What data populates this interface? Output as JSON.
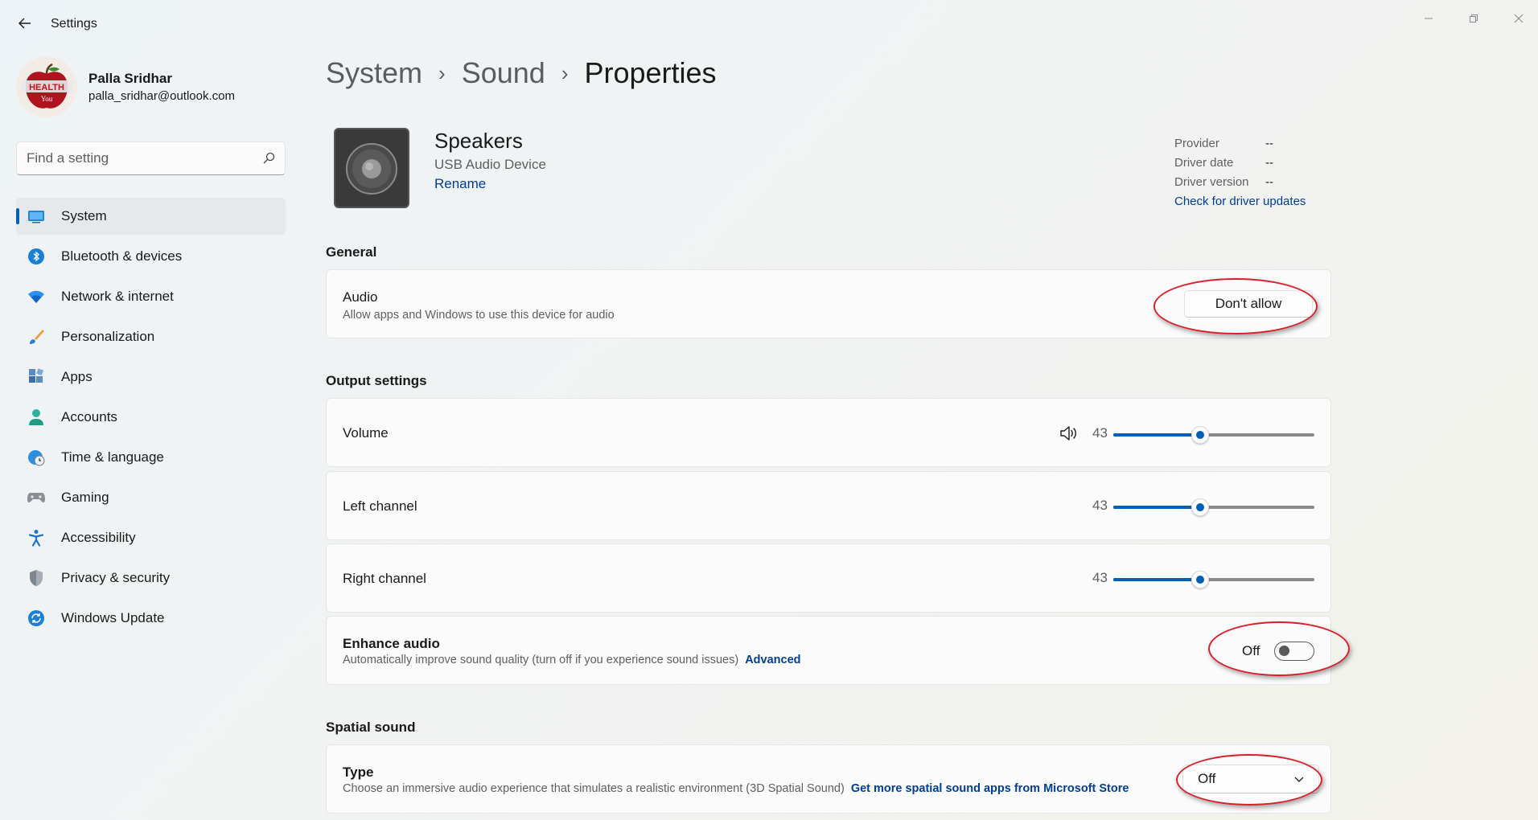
{
  "window": {
    "title": "Settings"
  },
  "profile": {
    "name": "Palla Sridhar",
    "email": "palla_sridhar@outlook.com",
    "avatar_text": "HEALTH You"
  },
  "search": {
    "placeholder": "Find a setting"
  },
  "nav": {
    "items": [
      {
        "label": "System",
        "icon": "system-icon",
        "active": true
      },
      {
        "label": "Bluetooth & devices",
        "icon": "bluetooth-icon"
      },
      {
        "label": "Network & internet",
        "icon": "wifi-icon"
      },
      {
        "label": "Personalization",
        "icon": "brush-icon"
      },
      {
        "label": "Apps",
        "icon": "apps-icon"
      },
      {
        "label": "Accounts",
        "icon": "person-icon"
      },
      {
        "label": "Time & language",
        "icon": "globe-clock-icon"
      },
      {
        "label": "Gaming",
        "icon": "gamepad-icon"
      },
      {
        "label": "Accessibility",
        "icon": "accessibility-icon"
      },
      {
        "label": "Privacy & security",
        "icon": "shield-icon"
      },
      {
        "label": "Windows Update",
        "icon": "update-icon"
      }
    ]
  },
  "breadcrumb": {
    "items": [
      "System",
      "Sound",
      "Properties"
    ]
  },
  "device": {
    "name": "Speakers",
    "subtitle": "USB Audio Device",
    "rename_label": "Rename"
  },
  "driver": {
    "provider_label": "Provider",
    "provider_value": "--",
    "date_label": "Driver date",
    "date_value": "--",
    "version_label": "Driver version",
    "version_value": "--",
    "update_link": "Check for driver updates"
  },
  "general": {
    "heading": "General",
    "audio": {
      "title": "Audio",
      "description": "Allow apps and Windows to use this device for audio",
      "button_label": "Don't allow"
    }
  },
  "output": {
    "heading": "Output settings",
    "volume": {
      "title": "Volume",
      "value": "43",
      "level": 43
    },
    "left": {
      "title": "Left channel",
      "value": "43",
      "level": 43
    },
    "right": {
      "title": "Right channel",
      "value": "43",
      "level": 43
    },
    "enhance": {
      "title": "Enhance audio",
      "description": "Automatically improve sound quality (turn off if you experience sound issues)",
      "link": "Advanced",
      "state_label": "Off",
      "on": false
    }
  },
  "spatial": {
    "heading": "Spatial sound",
    "type": {
      "title": "Type",
      "description": "Choose an immersive audio experience that simulates a realistic environment (3D Spatial Sound)",
      "link": "Get more spatial sound apps from Microsoft Store",
      "selected": "Off"
    }
  },
  "colors": {
    "accent": "#005fb8",
    "link": "#003e92",
    "annotation": "#d8202a"
  }
}
